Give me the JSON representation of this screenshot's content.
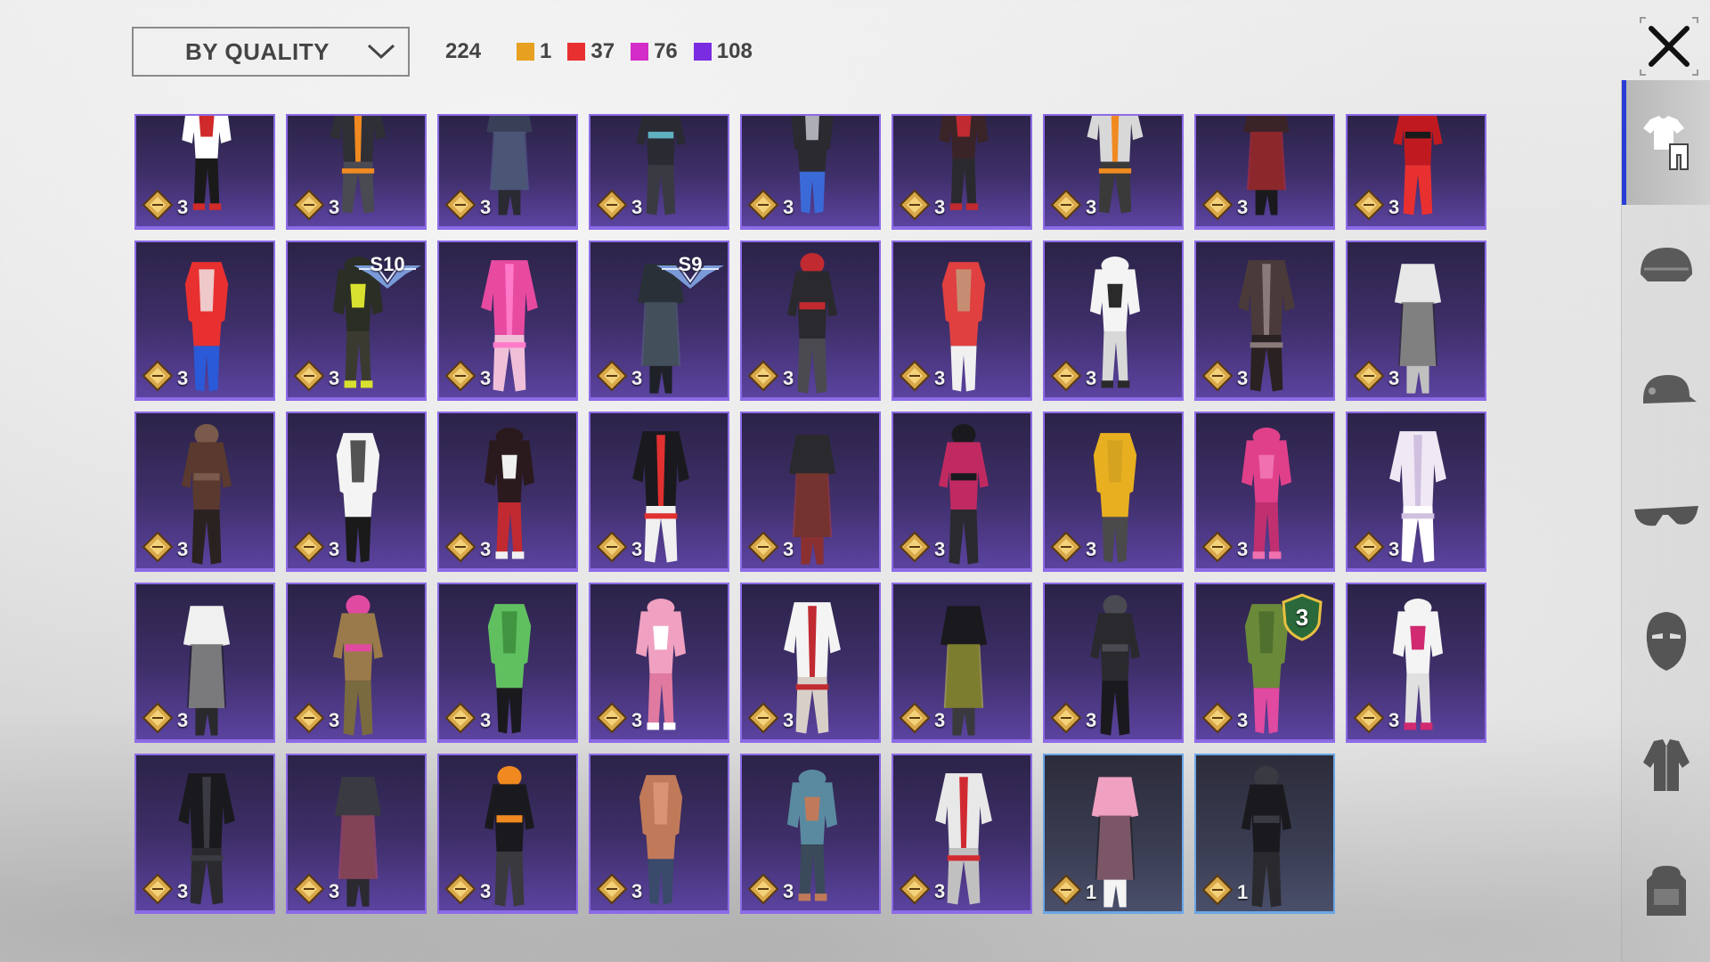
{
  "filter": {
    "sort_label": "BY QUALITY"
  },
  "summary": {
    "total": "224",
    "counts": [
      {
        "color": "#e8a020",
        "value": "1"
      },
      {
        "color": "#e83030",
        "value": "37"
      },
      {
        "color": "#d42cc8",
        "value": "76"
      },
      {
        "color": "#7a2ce0",
        "value": "108"
      }
    ]
  },
  "sidebar": {
    "items": [
      {
        "icon": "outfit-icon",
        "active": true
      },
      {
        "icon": "helmet-icon",
        "active": false
      },
      {
        "icon": "cap-icon",
        "active": false
      },
      {
        "icon": "glasses-icon",
        "active": false
      },
      {
        "icon": "mask-icon",
        "active": false
      },
      {
        "icon": "jacket-icon",
        "active": false
      },
      {
        "icon": "backpack-icon",
        "active": false
      }
    ]
  },
  "inventory": {
    "items": [
      {
        "qty": "3",
        "rarity": "purple",
        "palette": [
          "#ffffff",
          "#d02a2a",
          "#1a1a1a"
        ]
      },
      {
        "qty": "3",
        "rarity": "purple",
        "palette": [
          "#2f2f36",
          "#f08a20",
          "#4a4a52"
        ]
      },
      {
        "qty": "3",
        "rarity": "purple",
        "palette": [
          "#3a3f58",
          "#5a6a90",
          "#2a2a32"
        ]
      },
      {
        "qty": "3",
        "rarity": "purple",
        "palette": [
          "#2a2a32",
          "#5fb0c0",
          "#3a3a42"
        ]
      },
      {
        "qty": "3",
        "rarity": "purple",
        "palette": [
          "#2a2a30",
          "#3a6ad8",
          "#d0d0d8"
        ]
      },
      {
        "qty": "3",
        "rarity": "purple",
        "palette": [
          "#3a2428",
          "#c02a30",
          "#2a2a2e"
        ]
      },
      {
        "qty": "3",
        "rarity": "purple",
        "palette": [
          "#d8d8d8",
          "#f08a20",
          "#3a3a3a"
        ]
      },
      {
        "qty": "3",
        "rarity": "purple",
        "palette": [
          "#3a2428",
          "#d02a30",
          "#1a1a1e"
        ]
      },
      {
        "qty": "3",
        "rarity": "purple",
        "palette": [
          "#c01a20",
          "#1a1a1a",
          "#e83030"
        ]
      },
      {
        "qty": "3",
        "rarity": "purple",
        "palette": [
          "#e83030",
          "#2a5ad8",
          "#f0f0f0"
        ]
      },
      {
        "qty": "3",
        "rarity": "purple",
        "palette": [
          "#2a2e24",
          "#d8e030",
          "#3a3a30"
        ],
        "season": "S10"
      },
      {
        "qty": "3",
        "rarity": "purple",
        "palette": [
          "#e84aa0",
          "#ff7ac8",
          "#f0c0d8"
        ]
      },
      {
        "qty": "3",
        "rarity": "purple",
        "palette": [
          "#2a3038",
          "#5a6a7a",
          "#1e2228"
        ],
        "season": "S9"
      },
      {
        "qty": "3",
        "rarity": "purple",
        "palette": [
          "#2a2a2e",
          "#c02a30",
          "#4a4a50"
        ]
      },
      {
        "qty": "3",
        "rarity": "purple",
        "palette": [
          "#e04040",
          "#f0f0f0",
          "#c0a080"
        ]
      },
      {
        "qty": "3",
        "rarity": "purple",
        "palette": [
          "#f4f4f4",
          "#2a2a2a",
          "#d8d8d8"
        ]
      },
      {
        "qty": "3",
        "rarity": "purple",
        "palette": [
          "#4a3a3a",
          "#8a7a7a",
          "#2a2222"
        ]
      },
      {
        "qty": "3",
        "rarity": "purple",
        "palette": [
          "#e8e8e8",
          "#2a2a2a",
          "#c0c0c0"
        ]
      },
      {
        "qty": "3",
        "rarity": "purple",
        "palette": [
          "#5a3a2e",
          "#7a5a4a",
          "#2a2220"
        ]
      },
      {
        "qty": "3",
        "rarity": "purple",
        "palette": [
          "#f4f4f4",
          "#1a1a1a",
          "#2a2a2a"
        ]
      },
      {
        "qty": "3",
        "rarity": "purple",
        "palette": [
          "#2a1a1e",
          "#f0f0f0",
          "#c02a30"
        ]
      },
      {
        "qty": "3",
        "rarity": "purple",
        "palette": [
          "#1a1a1e",
          "#e03030",
          "#f0f0f0"
        ]
      },
      {
        "qty": "3",
        "rarity": "purple",
        "palette": [
          "#2a2a2e",
          "#b03a30",
          "#8a3030"
        ]
      },
      {
        "qty": "3",
        "rarity": "purple",
        "palette": [
          "#c02a60",
          "#1a1a1e",
          "#2a2a2e"
        ]
      },
      {
        "qty": "3",
        "rarity": "purple",
        "palette": [
          "#e8b020",
          "#4a4a4a",
          "#d0a020"
        ]
      },
      {
        "qty": "3",
        "rarity": "purple",
        "palette": [
          "#e0408a",
          "#f070b0",
          "#c03070"
        ]
      },
      {
        "qty": "3",
        "rarity": "purple",
        "palette": [
          "#f0e8f4",
          "#d0c0e0",
          "#ffffff"
        ]
      },
      {
        "qty": "3",
        "rarity": "purple",
        "palette": [
          "#f0f0f0",
          "#1a1a1e",
          "#2a2a2e"
        ]
      },
      {
        "qty": "3",
        "rarity": "purple",
        "palette": [
          "#9a7a4a",
          "#e04aa0",
          "#7a6a40"
        ]
      },
      {
        "qty": "3",
        "rarity": "purple",
        "palette": [
          "#60c060",
          "#1a1a1e",
          "#3a8a3a"
        ]
      },
      {
        "qty": "3",
        "rarity": "purple",
        "palette": [
          "#f0a0c0",
          "#ffffff",
          "#e07aa0"
        ]
      },
      {
        "qty": "3",
        "rarity": "purple",
        "palette": [
          "#f4f4f4",
          "#c02a30",
          "#d8d0c8"
        ]
      },
      {
        "qty": "3",
        "rarity": "purple",
        "palette": [
          "#1a1a1e",
          "#d0d040",
          "#3a3a3e"
        ]
      },
      {
        "qty": "3",
        "rarity": "purple",
        "palette": [
          "#2a2a2e",
          "#4a4a52",
          "#1a1a1e"
        ]
      },
      {
        "qty": "3",
        "rarity": "purple",
        "palette": [
          "#6a8a3a",
          "#e04aa0",
          "#4a6a2a"
        ],
        "level": "3"
      },
      {
        "qty": "3",
        "rarity": "purple",
        "palette": [
          "#f4f4f4",
          "#d02a70",
          "#e0e0e0"
        ]
      },
      {
        "qty": "3",
        "rarity": "purple",
        "palette": [
          "#1a1a1e",
          "#3a3a42",
          "#2a2a2e"
        ]
      },
      {
        "qty": "3",
        "rarity": "purple",
        "palette": [
          "#3a3a42",
          "#c04a6a",
          "#2a2a30"
        ]
      },
      {
        "qty": "3",
        "rarity": "purple",
        "palette": [
          "#1a1a1e",
          "#f08a20",
          "#3a3a3e"
        ]
      },
      {
        "qty": "3",
        "rarity": "purple",
        "palette": [
          "#c07a5a",
          "#3a4a6a",
          "#e09a7a"
        ]
      },
      {
        "qty": "3",
        "rarity": "purple",
        "palette": [
          "#5a8aa0",
          "#c07a5a",
          "#3a4a5a"
        ]
      },
      {
        "qty": "3",
        "rarity": "purple",
        "palette": [
          "#e8e8e8",
          "#d02a30",
          "#c0c0c0"
        ]
      },
      {
        "qty": "1",
        "rarity": "blue",
        "palette": [
          "#f0a0c0",
          "#1a1a1e",
          "#f4f4f4"
        ]
      },
      {
        "qty": "1",
        "rarity": "blue",
        "palette": [
          "#1a1a1e",
          "#3a3a42",
          "#2a2a2e"
        ]
      }
    ]
  }
}
